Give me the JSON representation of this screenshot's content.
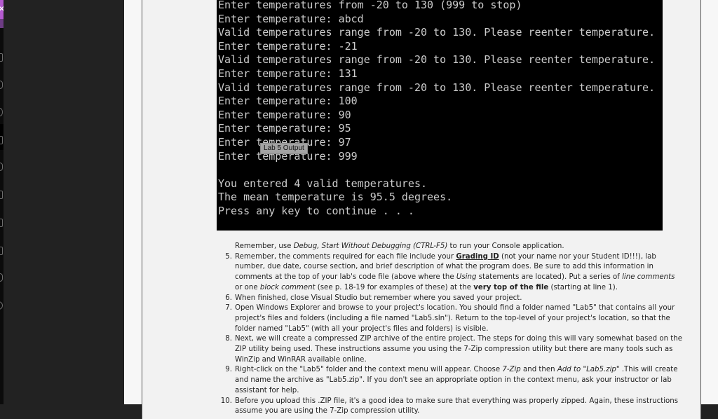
{
  "sidebar": {
    "close_button_glyph": "×",
    "icons": [
      {
        "name": "library-icon"
      },
      {
        "name": "bookmark-icon"
      },
      {
        "name": "globe-icon"
      },
      {
        "name": "notes-icon"
      },
      {
        "name": "person-icon"
      },
      {
        "name": "calendar-icon"
      },
      {
        "name": "mail-icon"
      },
      {
        "name": "download-icon"
      },
      {
        "name": "tools-icon"
      },
      {
        "name": "share-icon"
      }
    ]
  },
  "console": {
    "lines": [
      "Enter temperatures from -20 to 130 (999 to stop)",
      "Enter temperature: abcd",
      "Valid temperatures range from -20 to 130. Please reenter temperature.",
      "Enter temperature: -21",
      "Valid temperatures range from -20 to 130. Please reenter temperature.",
      "Enter temperature: 131",
      "Valid temperatures range from -20 to 130. Please reenter temperature.",
      "Enter temperature: 100",
      "Enter temperature: 90",
      "Enter temperature: 95",
      "Enter temperature: 97",
      "Enter temperature: 999",
      "",
      "You entered 4 valid temperatures.",
      "The mean temperature is 95.5 degrees.",
      "Press any key to continue . . ."
    ],
    "tooltip": "Lab 5 Output"
  },
  "instructions": {
    "intro": {
      "a": "Remember, use ",
      "b": "Debug, Start Without Debugging (CTRL-F5)",
      "c": " to run your Console application."
    },
    "items": [
      {
        "num": "5.",
        "p1": "Remember, the comments required for each file include your ",
        "p2": "Grading ID",
        "p3": " (not your name nor your Student ID!!!), lab number, due date, course section, and brief description of what the program does. Be sure to add this information in comments at the top of your lab's code file (above where the ",
        "p4": "Using",
        "p5": " statements are located). Put a series of ",
        "p6": "line comments",
        "p7": " or one ",
        "p8": "block comment",
        "p9": " (see p. 18-19 for examples of these) at the ",
        "p10": "very top of the file",
        "p11": " (starting at line 1)."
      },
      {
        "num": "6.",
        "text": "When finished, close Visual Studio but remember where you saved your project."
      },
      {
        "num": "7.",
        "text": "Open Windows Explorer and browse to your project's location. You should find a folder named \"Lab5\" that contains all your project's files and folders (including a file named \"Lab5.sln\"). Return to the top-level of your project's location, so that the folder named \"Lab5\" (with all your project's files and folders) is visible."
      },
      {
        "num": "8.",
        "text": "Next, we will create a compressed ZIP archive of the entire project. The steps for doing this will vary somewhat based on the ZIP utility being used. These instructions assume you using the 7-Zip compression utility but there are many tools such as WinZip and WinRAR available online."
      },
      {
        "num": "9.",
        "p1": "Right-click on the \"Lab5\" folder and the context menu will appear. Choose ",
        "p2": "7-Zip",
        "p3": " and then ",
        "p4": "Add to \"Lab5.zip\"",
        "p5": " .This will create and name the archive as \"Lab5.zip\". If you don't see an appropriate option in the context menu, ask your instructor or lab assistant for help."
      },
      {
        "num": "10.",
        "text": "Before you upload this .ZIP file, it's a good idea to make sure that everything was properly zipped. Again, these instructions assume you are using the 7-Zip compression utility."
      }
    ]
  }
}
